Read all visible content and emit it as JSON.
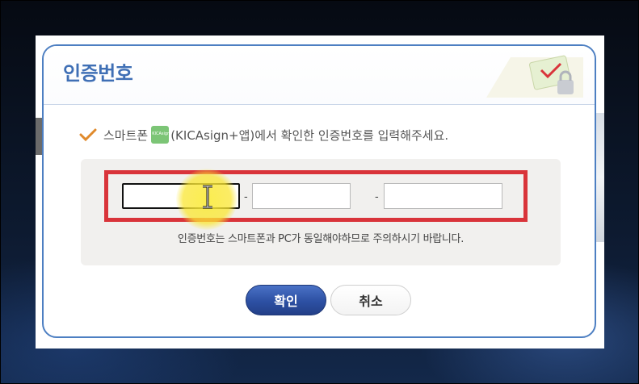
{
  "dialog": {
    "title": "인증번호",
    "instruction_before": "스마트폰",
    "app_icon_text": "KICAsign",
    "instruction_after": "(KICAsign+앱)에서 확인한 인증번호를 입력해주세요.",
    "code_fields": [
      {
        "value": "",
        "placeholder": ""
      },
      {
        "value": "",
        "placeholder": ""
      },
      {
        "value": "",
        "placeholder": ""
      }
    ],
    "separator": "-",
    "notice": "인증번호는 스마트폰과 PC가 동일해야하므로 주의하시기 바랍니다.",
    "confirm_label": "확인",
    "cancel_label": "취소"
  },
  "colors": {
    "accent": "#3f6fb5",
    "highlight": "#d9343a",
    "confirm_button": "#2d50a3",
    "check": "#e08a2c",
    "cursor_halo": "#f7e43a"
  },
  "icons": [
    "check-icon",
    "kicasign-app-icon",
    "text-cursor-icon",
    "lock-icon"
  ]
}
